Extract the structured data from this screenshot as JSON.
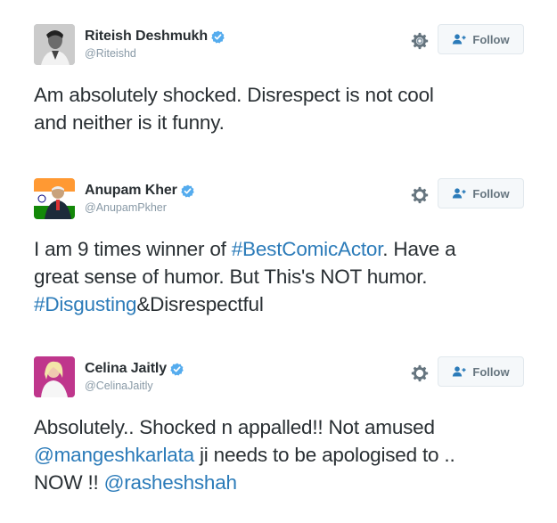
{
  "colors": {
    "text": "#292f33",
    "muted": "#8899a6",
    "link": "#2b7bb9",
    "verified": "#55acee",
    "follow_button_bg": "#f5f8fa",
    "follow_button_border": "#e1e8ed"
  },
  "tweets": [
    {
      "display_name": "Riteish Deshmukh",
      "handle": "@Riteishd",
      "verified": true,
      "follow_label": "Follow",
      "icons": [
        "gear-icon",
        "follow-person-icon",
        "verified-badge-icon"
      ],
      "text": {
        "line1": "Am absolutely shocked. Disrespect is not cool",
        "line2": "and neither is it funny."
      }
    },
    {
      "display_name": "Anupam Kher",
      "handle": "@AnupamPkher",
      "verified": true,
      "follow_label": "Follow",
      "icons": [
        "gear-icon",
        "follow-person-icon",
        "verified-badge-icon"
      ],
      "text": {
        "line1_a": "I am 9 times winner of ",
        "line1_hashtag": "#BestComicActor",
        "line1_b": ". Have a",
        "line2": "great sense of humor. But This's NOT humor.",
        "line3_hashtag": "#Disgusting",
        "line3_b": "&Disrespectful"
      }
    },
    {
      "display_name": "Celina Jaitly",
      "handle": "@CelinaJaitly",
      "verified": true,
      "follow_label": "Follow",
      "icons": [
        "gear-icon",
        "follow-person-icon",
        "verified-badge-icon"
      ],
      "text": {
        "line1": "Absolutely.. Shocked n appalled!! Not amused",
        "line2_mention": "@mangeshkarlata",
        "line2_b": " ji needs to be apologised to ..",
        "line3_a": "NOW !! ",
        "line3_mention": "@rasheshshah"
      }
    }
  ]
}
